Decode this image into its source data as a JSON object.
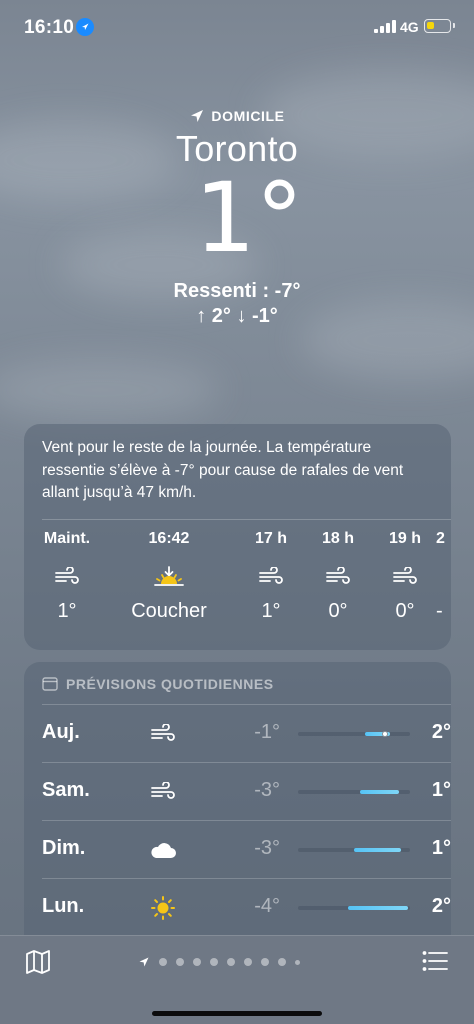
{
  "status": {
    "time": "16:10",
    "network": "4G",
    "battery_color": "#f5d60b",
    "battery_level": 0.35
  },
  "location": {
    "tag": "DOMICILE",
    "city": "Toronto",
    "temperature": "1°",
    "feels_like": "Ressenti : -7°",
    "high_low": "↑ 2°  ↓ -1°"
  },
  "hourly": {
    "description": "Vent pour le reste de la journée. La température ressentie s’élève à -7° pour cause de rafales de vent allant jusqu’à 47 km/h.",
    "items": [
      {
        "label": "Maint.",
        "icon": "wind-icon",
        "value": "1°"
      },
      {
        "label": "16:42",
        "icon": "sunset-icon",
        "value": "Coucher"
      },
      {
        "label": "17 h",
        "icon": "wind-icon",
        "value": "1°"
      },
      {
        "label": "18 h",
        "icon": "wind-icon",
        "value": "0°"
      },
      {
        "label": "19 h",
        "icon": "wind-icon",
        "value": "0°"
      },
      {
        "label": "2",
        "icon": "wind-icon",
        "value": "-"
      }
    ]
  },
  "daily": {
    "title": "PRÉVISIONS QUOTIDIENNES",
    "range_min": -4,
    "range_max": 2,
    "days": [
      {
        "name": "Auj.",
        "icon": "wind-icon",
        "low": "-1°",
        "high": "2°",
        "bar_start": 0.6,
        "bar_end": 0.82,
        "current": 0.78
      },
      {
        "name": "Sam.",
        "icon": "wind-icon",
        "low": "-3°",
        "high": "1°",
        "bar_start": 0.55,
        "bar_end": 0.9
      },
      {
        "name": "Dim.",
        "icon": "cloud-icon",
        "low": "-3°",
        "high": "1°",
        "bar_start": 0.5,
        "bar_end": 0.92
      },
      {
        "name": "Lun.",
        "icon": "sun-icon",
        "low": "-4°",
        "high": "2°",
        "bar_start": 0.45,
        "bar_end": 0.98
      }
    ]
  },
  "pages": {
    "count": 10,
    "active": 0
  }
}
